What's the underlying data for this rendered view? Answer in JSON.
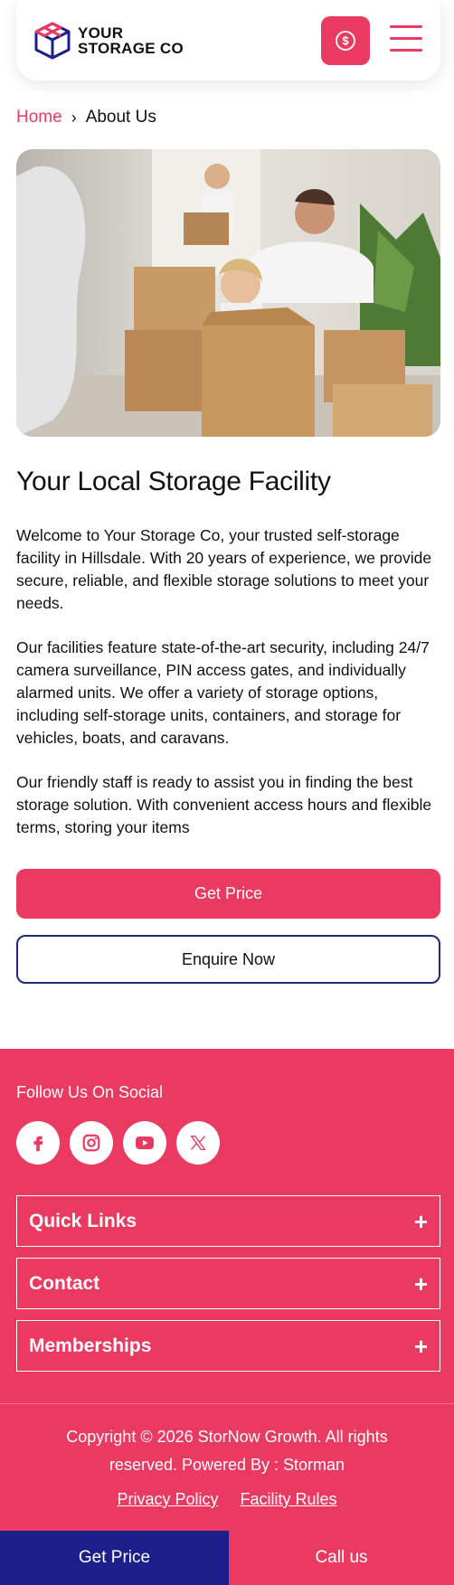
{
  "header": {
    "logo_line1": "YOUR",
    "logo_line2": "STORAGE CO",
    "price_icon": "dollar-coin-icon",
    "menu_icon": "hamburger-menu-icon"
  },
  "breadcrumb": {
    "home": "Home",
    "separator": "›",
    "current": "About Us"
  },
  "hero": {
    "icon": "family-moving-boxes-photo"
  },
  "content": {
    "title": "Your Local Storage Facility",
    "paragraphs": [
      "Welcome to Your Storage Co, your trusted self-storage facility in Hillsdale. With 20 years of experience, we provide secure, reliable, and flexible storage solutions to meet your needs.",
      "Our facilities feature state-of-the-art security, including 24/7 camera surveillance, PIN access gates, and individually alarmed units. We offer a variety of storage options, including self-storage units, containers, and storage for vehicles, boats, and caravans.",
      "Our friendly staff is ready to assist you in finding the best storage solution. With convenient access hours and flexible terms, storing your items"
    ],
    "get_price_label": "Get Price",
    "enquire_label": "Enquire Now"
  },
  "footer": {
    "follow_label": "Follow Us On Social",
    "socials": [
      "facebook-icon",
      "instagram-icon",
      "youtube-icon",
      "x-twitter-icon"
    ],
    "accordions": [
      {
        "label": "Quick Links",
        "icon": "+"
      },
      {
        "label": "Contact",
        "icon": "+"
      },
      {
        "label": "Memberships",
        "icon": "+"
      }
    ],
    "copyright": "Copyright © 2026 StorNow Growth. All rights reserved. Powered By : Storman",
    "privacy": "Privacy Policy",
    "rules": "Facility Rules"
  },
  "bottom_bar": {
    "left_label": "Get Price",
    "right_label": "Call us"
  },
  "colors": {
    "accent": "#ea3a62",
    "navy": "#1c1f8a"
  }
}
